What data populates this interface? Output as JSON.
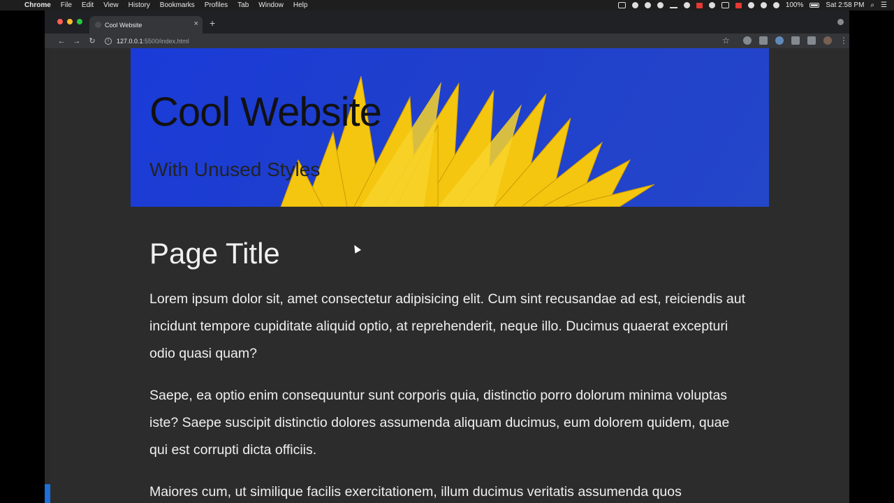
{
  "menubar": {
    "app": "Chrome",
    "items": [
      "File",
      "Edit",
      "View",
      "History",
      "Bookmarks",
      "Profiles",
      "Tab",
      "Window",
      "Help"
    ],
    "battery": "100%",
    "clock": "Sat 2:58 PM"
  },
  "browser": {
    "tab_title": "Cool Website",
    "url_host": "127.0.0.1",
    "url_path": ":5500/index.html"
  },
  "page": {
    "hero_title": "Cool Website",
    "hero_subtitle": "With Unused Styles",
    "title": "Page Title",
    "paragraphs": [
      "Lorem ipsum dolor sit, amet consectetur adipisicing elit. Cum sint recusandae ad est, reiciendis aut incidunt tempore cupiditate aliquid optio, at reprehenderit, neque illo. Ducimus quaerat excepturi odio quasi quam?",
      "Saepe, ea optio enim consequuntur sunt corporis quia, distinctio porro dolorum minima voluptas iste? Saepe suscipit distinctio dolores assumenda aliquam ducimus, eum dolorem quidem, quae qui est corrupti dicta officiis.",
      "Maiores cum, ut similique facilis exercitationem, illum ducimus veritatis assumenda quos"
    ]
  },
  "colors": {
    "hero_blue": "#1f3fcc",
    "page_bg": "#2c2c2c",
    "petal_yellow": "#f5c60f"
  }
}
